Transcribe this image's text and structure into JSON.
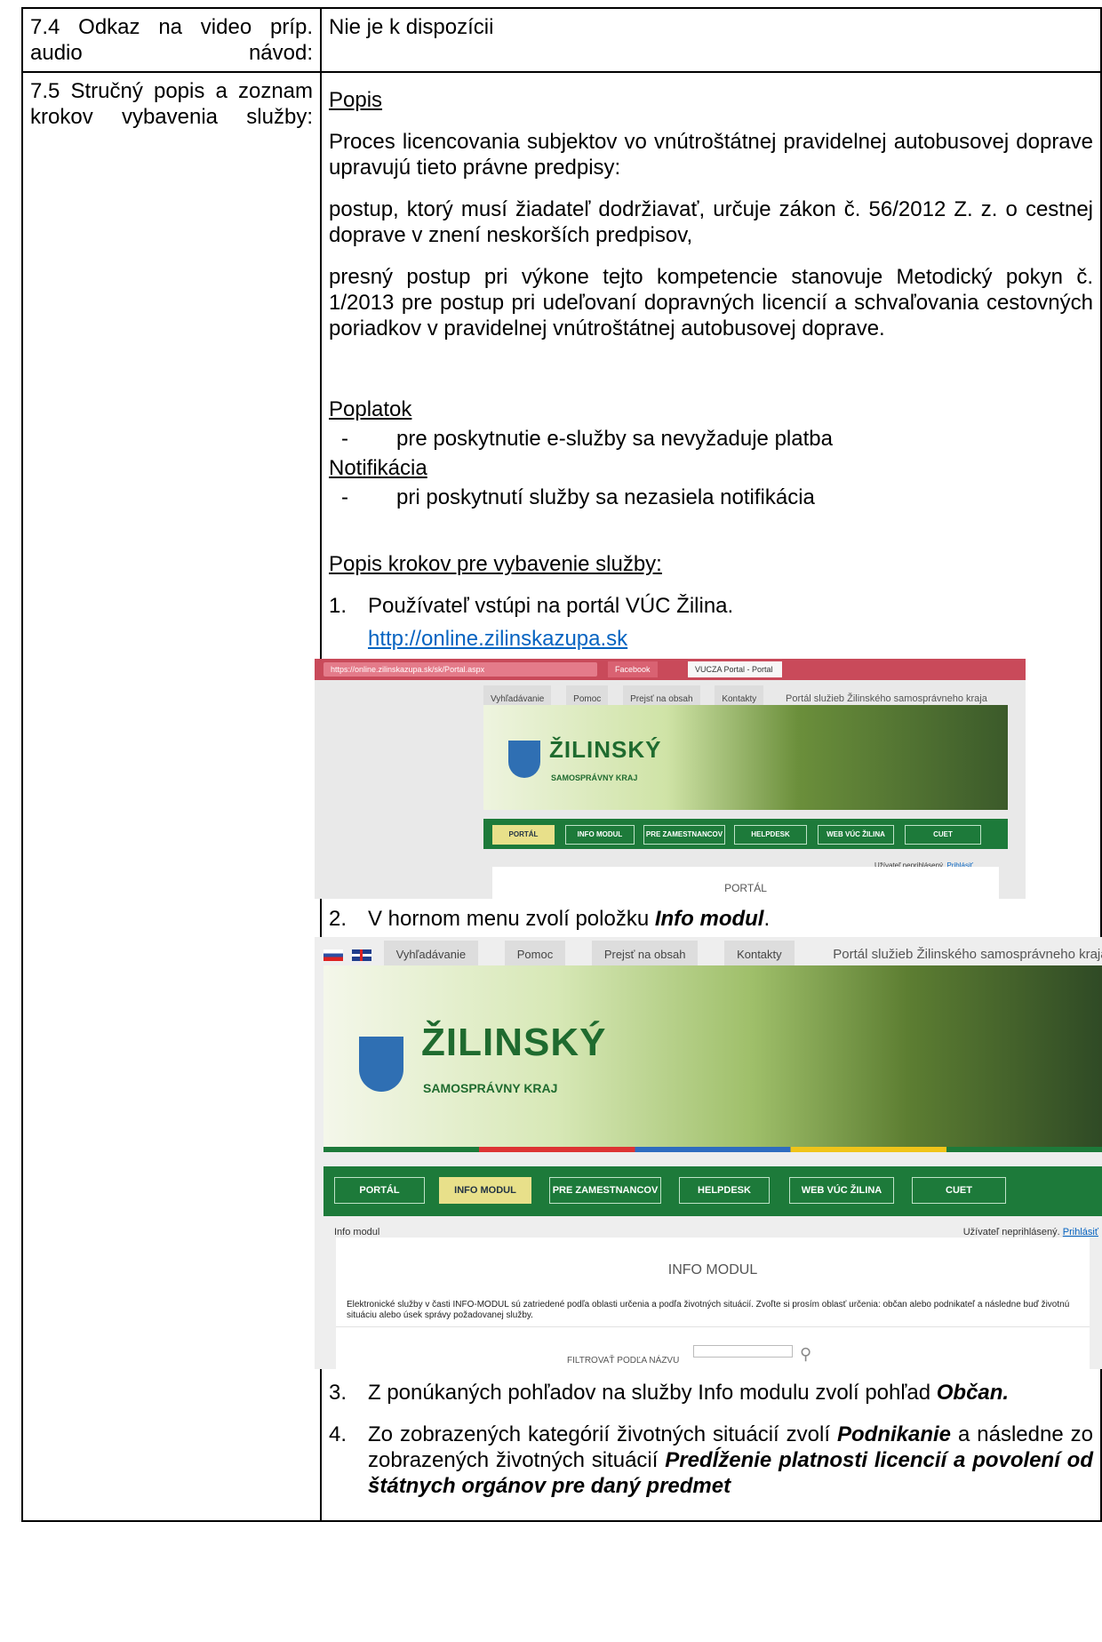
{
  "row_74": {
    "label": "7.4 Odkaz na video príp. audio návod:",
    "value": "Nie je k dispozícii"
  },
  "row_75": {
    "label": "7.5 Stručný popis a zoznam krokov vybavenia služby:",
    "popis_heading": "Popis",
    "paragraphs": [
      "Proces licencovania subjektov vo vnútroštátnej pravidelnej autobusovej doprave upravujú tieto právne predpisy:",
      "postup, ktorý musí žiadateľ dodržiavať, určuje zákon č. 56/2012 Z. z. o cestnej doprave v znení neskorších predpisov,",
      "presný postup pri výkone tejto kompetencie stanovuje Metodický pokyn č. 1/2013 pre postup pri udeľovaní dopravných licencií a schvaľovania cestovných poriadkov v pravidelnej vnútroštátnej autobusovej doprave."
    ],
    "poplatok_heading": "Poplatok",
    "poplatok_item": "pre poskytnutie e-služby sa nevyžaduje platba",
    "notifikacia_heading": "Notifikácia",
    "notifikacia_item": "pri poskytnutí služby sa nezasiela notifikácia",
    "steps_heading": "Popis krokov pre vybavenie služby:",
    "dash": "-",
    "steps": {
      "s1_num": "1.",
      "s1_text": "Používateľ vstúpi na portál VÚC Žilina.",
      "s1_link": "http://online.zilinskazupa.sk",
      "s2_num": "2.",
      "s2_text_a": "V hornom menu zvolí položku ",
      "s2_text_b": "Info modul",
      "s2_text_c": ".",
      "s3_num": "3.",
      "s3_text_a": "Z ponúkaných pohľadov na služby Info modulu zvolí pohľad ",
      "s3_text_b": "Občan.",
      "s4_num": "4.",
      "s4_text_a": "Zo zobrazených kategórií životných situácií zvolí ",
      "s4_text_b": "Podnikanie",
      "s4_text_c": " a následne zo zobrazených životných situácií ",
      "s4_text_d": "Predĺženie platnosti licencií a povolení od štátnych orgánov pre daný predmet"
    }
  },
  "screenshot1": {
    "url": "https://online.zilinskazupa.sk/sk/Portal.aspx",
    "tab_facebook": "Facebook",
    "tab_active": "VUCZA Portal - Portal",
    "search": "Vyhľadávanie",
    "help": "Pomoc",
    "skip": "Prejsť na obsah",
    "contacts": "Kontakty",
    "portal_title": "Portál služieb Žilinského samosprávneho kraja",
    "brand": "ŽILINSKÝ",
    "brand_sub": "SAMOSPRÁVNY KRAJ",
    "nav": [
      "PORTÁL",
      "INFO MODUL",
      "PRE ZAMESTNANCOV",
      "HELPDESK",
      "WEB VÚC ŽILINA",
      "CUET"
    ],
    "login_text": "Užívateľ neprihlásený.",
    "login_link": "Prihlásiť",
    "content_title": "PORTÁL"
  },
  "screenshot2": {
    "search": "Vyhľadávanie",
    "help": "Pomoc",
    "skip": "Prejsť na obsah",
    "contacts": "Kontakty",
    "portal_title": "Portál služieb Žilinského samosprávneho kraja",
    "brand": "ŽILINSKÝ",
    "brand_sub": "SAMOSPRÁVNY KRAJ",
    "nav": [
      "PORTÁL",
      "INFO MODUL",
      "PRE ZAMESTNANCOV",
      "HELPDESK",
      "WEB VÚC ŽILINA",
      "CUET"
    ],
    "breadcrumb": "Info modul",
    "login_text": "Užívateľ neprihlásený.",
    "login_link": "Prihlásiť",
    "content_title": "INFO MODUL",
    "content_desc": "Elektronické služby v časti INFO-MODUL sú zatriedené podľa oblasti určenia a podľa životných situácií. Zvoľte si prosím oblasť určenia: občan alebo podnikateľ a následne buď životnú situáciu alebo úsek správy požadovanej služby.",
    "filter_label": "FILTROVAŤ PODĽA NÁZVU"
  },
  "colors": {
    "link": "#0563c1",
    "nav_green": "#1d7a3a",
    "brand_green": "#1f6b2f"
  },
  "icons": [
    "search-icon",
    "flag-sk-icon",
    "flag-uk-icon",
    "crest-icon"
  ]
}
